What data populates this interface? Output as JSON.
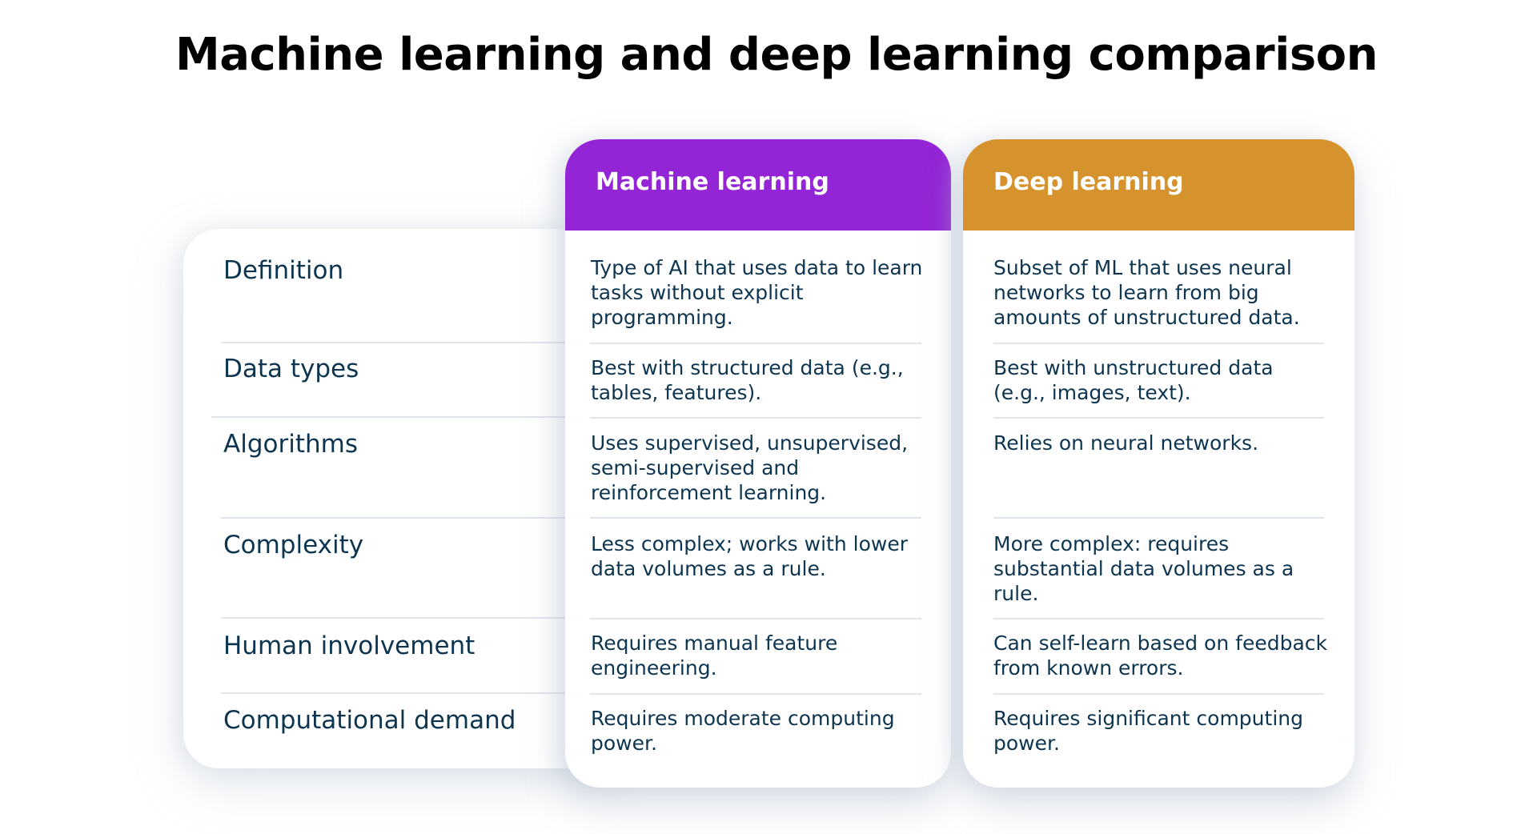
{
  "title": "Machine learning and deep learning comparison",
  "rows": [
    {
      "label": "Definition"
    },
    {
      "label": "Data types"
    },
    {
      "label": "Algorithms"
    },
    {
      "label": "Complexity"
    },
    {
      "label": "Human involvement"
    },
    {
      "label": "Computational demand"
    }
  ],
  "columns": [
    {
      "header": "Machine learning",
      "color": "#9425d6",
      "cells": [
        "Type of AI that uses data to learn tasks without explicit programming.",
        "Best with structured data (e.g., tables, features).",
        "Uses supervised, unsupervised, semi-supervised and reinforcement learning.",
        "Less complex; works with lower data volumes as a rule.",
        "Requires manual feature engineering.",
        "Requires moderate computing power."
      ]
    },
    {
      "header": "Deep learning",
      "color": "#d6922c",
      "cells": [
        "Subset of ML that uses neural networks to learn from big amounts of unstructured data.",
        "Best with unstructured data (e.g., images, text).",
        "Relies on neural networks.",
        "More complex: requires substantial data volumes as a rule.",
        "Can self-learn based on feedback from known errors.",
        "Requires significant computing power."
      ]
    }
  ]
}
